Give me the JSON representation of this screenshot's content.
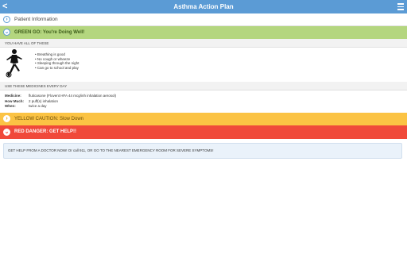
{
  "header": {
    "title": "Asthma Action Plan",
    "back_glyph": "<",
    "menu_icon": "hamburger-icon"
  },
  "patient": {
    "label": "Patient Information"
  },
  "green_zone": {
    "label": "GREEN GO: You're Doing Well!",
    "color": "#b4d67f",
    "subheader": "YOU HAVE ALL OF THESE",
    "symptoms": [
      "Breathing is good",
      "No cough or wheeze",
      "Sleeping through the night",
      "Can go to school and play"
    ],
    "meds_subheader": "USE THESE MEDICINES EVERY DAY",
    "medication": {
      "medicine_key": "Medicine:",
      "medicine_value": "fluticasone (Flovent HFA 44 mcg/inh inhalation aerosol)",
      "how_much_key": "How Much:",
      "how_much_value": "2 puff(s) inhalation",
      "when_key": "When:",
      "when_value": "twice a day"
    }
  },
  "yellow_zone": {
    "label": "YELLOW CAUTION: Slow Down",
    "color": "#fbc344"
  },
  "red_zone": {
    "label": "RED DANGER: GET HELP!!",
    "color": "#f0493a",
    "message": "GET HELP FROM A DOCTOR NOW! Or call 911, OR GO TO THE NEAREST EMERGENCY ROOM FOR SEVERE SYMPTOMS!"
  }
}
